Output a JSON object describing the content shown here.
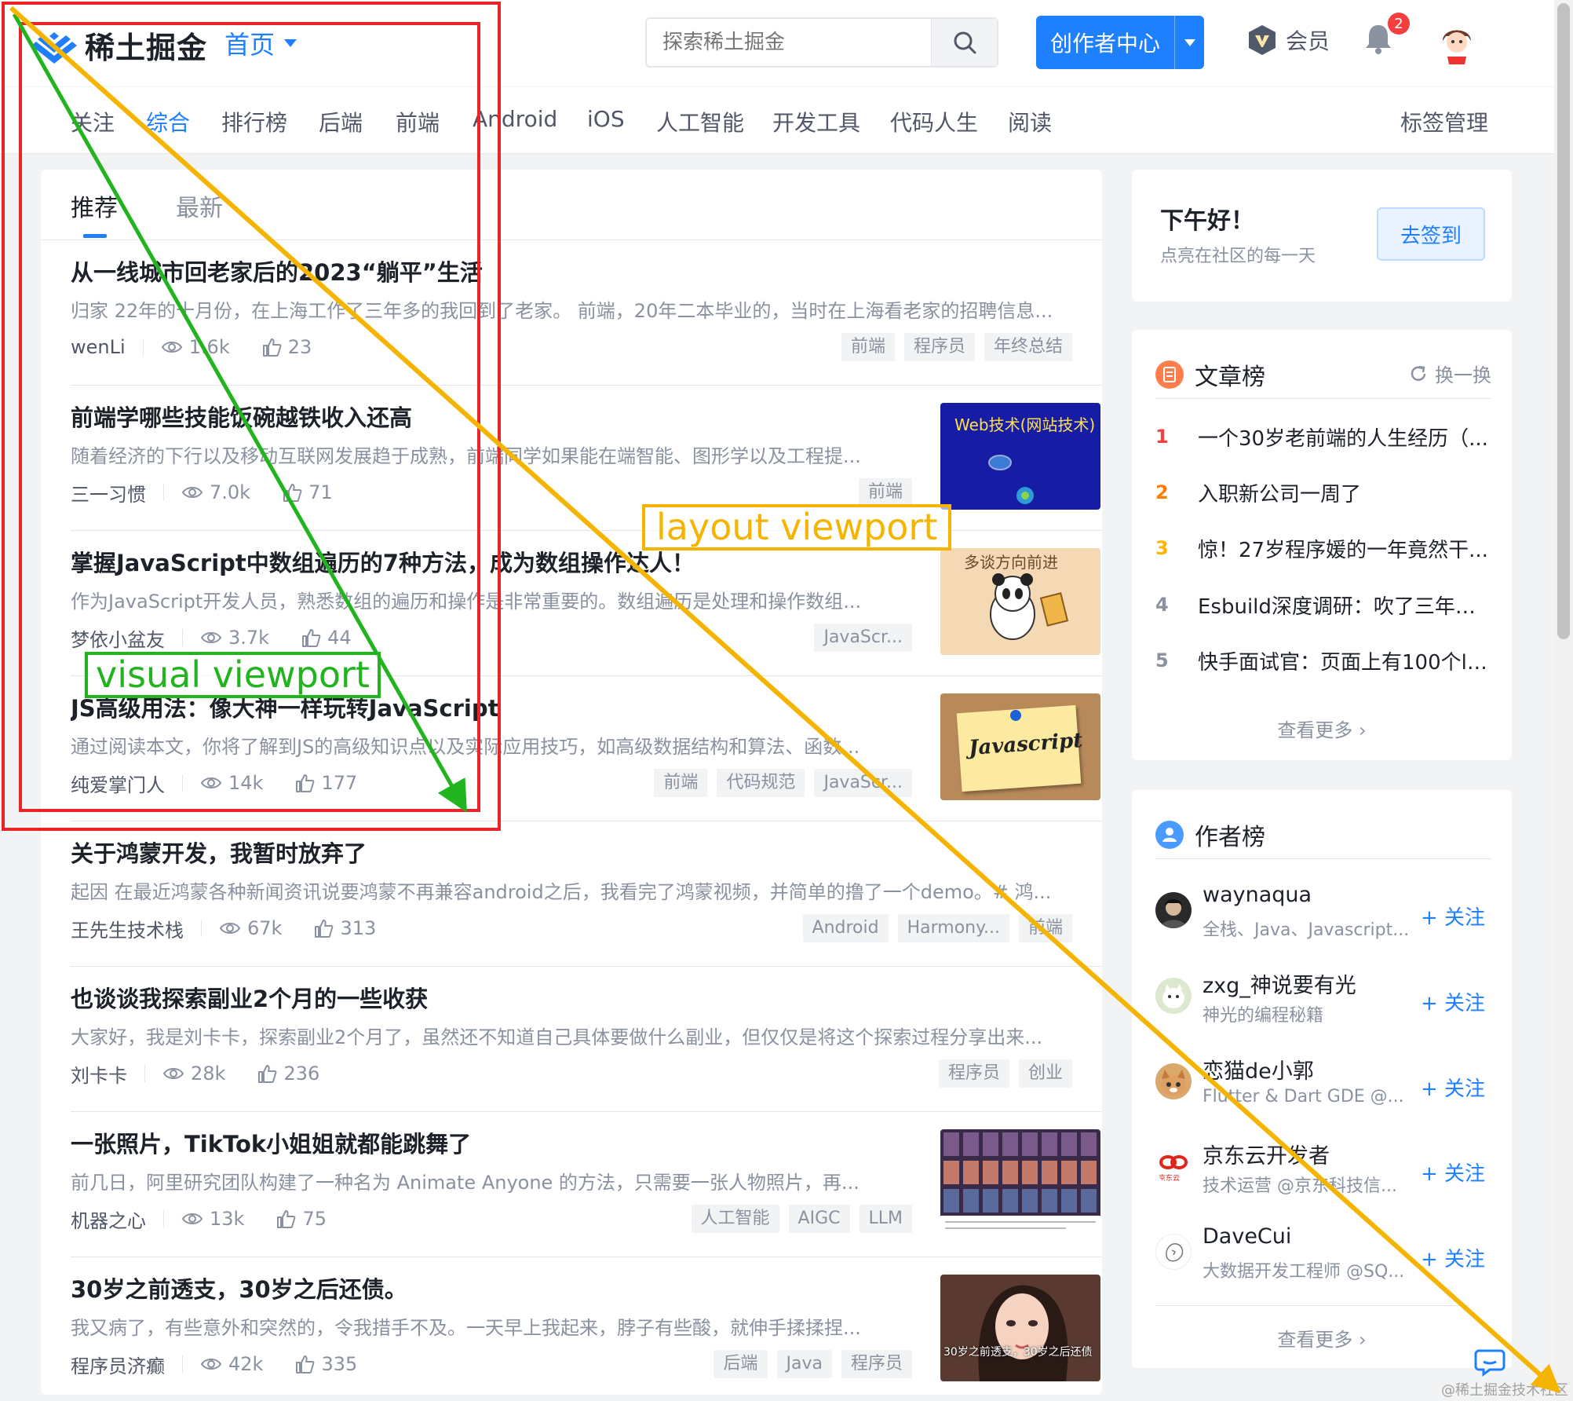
{
  "header": {
    "logo_text": "稀土掘金",
    "nav_home": "首页",
    "search_placeholder": "探索稀土掘金",
    "creator_button": "创作者中心",
    "member_label": "会员",
    "notification_count": "2"
  },
  "categories": {
    "items": [
      "关注",
      "综合",
      "排行榜",
      "后端",
      "前端",
      "Android",
      "iOS",
      "人工智能",
      "开发工具",
      "代码人生",
      "阅读"
    ],
    "active_index": 1,
    "tag_manage": "标签管理"
  },
  "tabs": {
    "recommend": "推荐",
    "latest": "最新"
  },
  "articles": [
    {
      "title": "从一线城市回老家后的2023“躺平”生活",
      "brief": "归家 22年的十月份，在上海工作了三年多的我回到了老家。 前端，20年二本毕业的，当时在上海看老家的招聘信息...",
      "author": "wenLi",
      "views": "1.6k",
      "likes": "23",
      "tags": [
        "前端",
        "程序员",
        "年终总结"
      ]
    },
    {
      "title": "前端学哪些技能饭碗越铁收入还高",
      "brief": "随着经济的下行以及移动互联网发展趋于成熟，前端同学如果能在端智能、图形学以及工程提...",
      "author": "三一习惯",
      "views": "7.0k",
      "likes": "71",
      "tags": [
        "前端"
      ],
      "thumb_text": "Web技术(网站技术)"
    },
    {
      "title": "掌握JavaScript中数组遍历的7种方法，成为数组操作达人！",
      "brief": "作为JavaScript开发人员，熟悉数组的遍历和操作是非常重要的。数组遍历是处理和操作数组...",
      "author": "梦依小盆友",
      "views": "3.7k",
      "likes": "44",
      "tags": [
        "JavaScr..."
      ],
      "thumb_text": "多谈方向前进"
    },
    {
      "title": "JS高级用法：像大神一样玩转JavaScript",
      "brief": "通过阅读本文，你将了解到JS的高级知识点以及实际应用技巧，如高级数据结构和算法、函数...",
      "author": "纯爱掌门人",
      "views": "14k",
      "likes": "177",
      "tags": [
        "前端",
        "代码规范",
        "JavaScr..."
      ],
      "thumb_text": "Javascript"
    },
    {
      "title": "关于鸿蒙开发，我暂时放弃了",
      "brief": "起因 在最近鸿蒙各种新闻资讯说要鸿蒙不再兼容android之后，我看完了鸿蒙视频，并简单的撸了一个demo。# 鸿...",
      "author": "王先生技术栈",
      "views": "67k",
      "likes": "313",
      "tags": [
        "Android",
        "Harmony...",
        "前端"
      ]
    },
    {
      "title": "也谈谈我探索副业2个月的一些收获",
      "brief": "大家好，我是刘卡卡，探索副业2个月了，虽然还不知道自己具体要做什么副业，但仅仅是将这个探索过程分享出来...",
      "author": "刘卡卡",
      "views": "28k",
      "likes": "236",
      "tags": [
        "程序员",
        "创业"
      ]
    },
    {
      "title": "一张照片，TikTok小姐姐就都能跳舞了",
      "brief": "前几日，阿里研究团队构建了一种名为 Animate Anyone 的方法，只需要一张人物照片，再...",
      "author": "机器之心",
      "views": "13k",
      "likes": "75",
      "tags": [
        "人工智能",
        "AIGC",
        "LLM"
      ]
    },
    {
      "title": "30岁之前透支，30岁之后还债。",
      "brief": "我又病了，有些意外和突然的，令我措手不及。一天早上我起来，脖子有些酸，就伸手揉揉捏...",
      "author": "程序员济癫",
      "views": "42k",
      "likes": "335",
      "tags": [
        "后端",
        "Java",
        "程序员"
      ],
      "thumb_text": "30岁之前透支，30岁之后还债"
    }
  ],
  "sidebar": {
    "greeting": "下午好！",
    "greeting_sub": "点亮在社区的每一天",
    "signin_button": "去签到",
    "article_rank": {
      "title": "文章榜",
      "refresh": "换一换",
      "items": [
        {
          "num": "1",
          "text": "一个30岁老前端的人生经历（..."
        },
        {
          "num": "2",
          "text": "入职新公司一周了"
        },
        {
          "num": "3",
          "text": "惊！27岁程序媛的一年竟然干..."
        },
        {
          "num": "4",
          "text": "Esbuild深度调研：吹了三年，..."
        },
        {
          "num": "5",
          "text": "快手面试官：页面上有100个li..."
        }
      ],
      "more": "查看更多"
    },
    "author_rank": {
      "title": "作者榜",
      "items": [
        {
          "name": "waynaqua",
          "desc": "全栈、Java、Javascript...",
          "follow": "+ 关注"
        },
        {
          "name": "zxg_神说要有光",
          "desc": "神光的编程秘籍",
          "follow": "+ 关注"
        },
        {
          "name": "恋猫de小郭",
          "desc": "Flutter & Dart GDE @...",
          "follow": "+ 关注"
        },
        {
          "name": "京东云开发者",
          "desc": "技术运营 @京东科技信...",
          "follow": "+ 关注"
        },
        {
          "name": "DaveCui",
          "desc": "大数据开发工程师 @SQ...",
          "follow": "+ 关注"
        }
      ],
      "more": "查看更多",
      "jd_logo_text": "京东云"
    }
  },
  "annotations": {
    "visual_viewport": "visual viewport",
    "layout_viewport": "layout viewport"
  },
  "watermark": "@稀土掘金技术社区",
  "colors": {
    "brand": "#1e80ff",
    "visual_viewport": "#22b41e",
    "layout_viewport": "#f5b400",
    "highlight_box": "#e8262a",
    "rank_top": "#f53f3f",
    "rank_mid": "#ff7d00",
    "rank_third": "#ffb400"
  }
}
